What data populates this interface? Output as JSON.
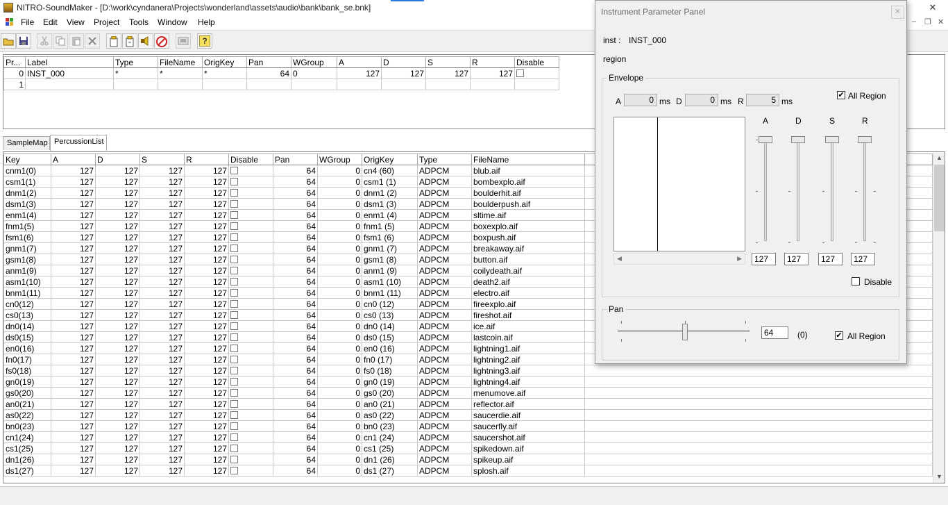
{
  "window": {
    "title": "NITRO-SoundMaker - [D:\\work\\cyndanera\\Projects\\wonderland\\assets\\audio\\bank\\bank_se.bnk]",
    "minimize": "—",
    "maximize": "☐",
    "close": "✕"
  },
  "menu": {
    "file": "File",
    "edit": "Edit",
    "view": "View",
    "project": "Project",
    "tools": "Tools",
    "window": "Window",
    "help": "Help",
    "mdi_min": "–",
    "mdi_restore": "❐",
    "mdi_close": "✕"
  },
  "toolbar": {
    "help_glyph": "?"
  },
  "instrument_table": {
    "headers": [
      "Pr...",
      "Label",
      "Type",
      "FileName",
      "OrigKey",
      "Pan",
      "WGroup",
      "A",
      "D",
      "S",
      "R",
      "Disable"
    ],
    "rows": [
      {
        "prg": "0",
        "label": "INST_000",
        "type": "*",
        "file": "*",
        "origkey": "*",
        "pan": "64",
        "wgroup": "0",
        "a": "127",
        "d": "127",
        "s": "127",
        "r": "127"
      },
      {
        "prg": "1",
        "label": "",
        "type": "",
        "file": "",
        "origkey": "",
        "pan": "",
        "wgroup": "",
        "a": "",
        "d": "",
        "s": "",
        "r": ""
      }
    ]
  },
  "tabs": {
    "samplemap": "SampleMap",
    "percussion": "PercussionList"
  },
  "perc_table": {
    "headers": [
      "Key",
      "A",
      "D",
      "S",
      "R",
      "Disable",
      "Pan",
      "WGroup",
      "OrigKey",
      "Type",
      "FileName"
    ],
    "rows": [
      {
        "key": "cnm1(0)",
        "a": "127",
        "d": "127",
        "s": "127",
        "r": "127",
        "pan": "64",
        "wg": "0",
        "ok": "cn4 (60)",
        "type": "ADPCM",
        "file": "blub.aif"
      },
      {
        "key": "csm1(1)",
        "a": "127",
        "d": "127",
        "s": "127",
        "r": "127",
        "pan": "64",
        "wg": "0",
        "ok": "csm1 (1)",
        "type": "ADPCM",
        "file": "bombexplo.aif"
      },
      {
        "key": "dnm1(2)",
        "a": "127",
        "d": "127",
        "s": "127",
        "r": "127",
        "pan": "64",
        "wg": "0",
        "ok": "dnm1 (2)",
        "type": "ADPCM",
        "file": "boulderhit.aif"
      },
      {
        "key": "dsm1(3)",
        "a": "127",
        "d": "127",
        "s": "127",
        "r": "127",
        "pan": "64",
        "wg": "0",
        "ok": "dsm1 (3)",
        "type": "ADPCM",
        "file": "boulderpush.aif"
      },
      {
        "key": "enm1(4)",
        "a": "127",
        "d": "127",
        "s": "127",
        "r": "127",
        "pan": "64",
        "wg": "0",
        "ok": "enm1 (4)",
        "type": "ADPCM",
        "file": "sltime.aif"
      },
      {
        "key": "fnm1(5)",
        "a": "127",
        "d": "127",
        "s": "127",
        "r": "127",
        "pan": "64",
        "wg": "0",
        "ok": "fnm1 (5)",
        "type": "ADPCM",
        "file": "boxexplo.aif"
      },
      {
        "key": "fsm1(6)",
        "a": "127",
        "d": "127",
        "s": "127",
        "r": "127",
        "pan": "64",
        "wg": "0",
        "ok": "fsm1 (6)",
        "type": "ADPCM",
        "file": "boxpush.aif"
      },
      {
        "key": "gnm1(7)",
        "a": "127",
        "d": "127",
        "s": "127",
        "r": "127",
        "pan": "64",
        "wg": "0",
        "ok": "gnm1 (7)",
        "type": "ADPCM",
        "file": "breakaway.aif"
      },
      {
        "key": "gsm1(8)",
        "a": "127",
        "d": "127",
        "s": "127",
        "r": "127",
        "pan": "64",
        "wg": "0",
        "ok": "gsm1 (8)",
        "type": "ADPCM",
        "file": "button.aif"
      },
      {
        "key": "anm1(9)",
        "a": "127",
        "d": "127",
        "s": "127",
        "r": "127",
        "pan": "64",
        "wg": "0",
        "ok": "anm1 (9)",
        "type": "ADPCM",
        "file": "coilydeath.aif"
      },
      {
        "key": "asm1(10)",
        "a": "127",
        "d": "127",
        "s": "127",
        "r": "127",
        "pan": "64",
        "wg": "0",
        "ok": "asm1 (10)",
        "type": "ADPCM",
        "file": "death2.aif"
      },
      {
        "key": "bnm1(11)",
        "a": "127",
        "d": "127",
        "s": "127",
        "r": "127",
        "pan": "64",
        "wg": "0",
        "ok": "bnm1 (11)",
        "type": "ADPCM",
        "file": "electro.aif"
      },
      {
        "key": "cn0(12)",
        "a": "127",
        "d": "127",
        "s": "127",
        "r": "127",
        "pan": "64",
        "wg": "0",
        "ok": "cn0 (12)",
        "type": "ADPCM",
        "file": "fireexplo.aif"
      },
      {
        "key": "cs0(13)",
        "a": "127",
        "d": "127",
        "s": "127",
        "r": "127",
        "pan": "64",
        "wg": "0",
        "ok": "cs0 (13)",
        "type": "ADPCM",
        "file": "fireshot.aif"
      },
      {
        "key": "dn0(14)",
        "a": "127",
        "d": "127",
        "s": "127",
        "r": "127",
        "pan": "64",
        "wg": "0",
        "ok": "dn0 (14)",
        "type": "ADPCM",
        "file": "ice.aif"
      },
      {
        "key": "ds0(15)",
        "a": "127",
        "d": "127",
        "s": "127",
        "r": "127",
        "pan": "64",
        "wg": "0",
        "ok": "ds0 (15)",
        "type": "ADPCM",
        "file": "lastcoin.aif"
      },
      {
        "key": "en0(16)",
        "a": "127",
        "d": "127",
        "s": "127",
        "r": "127",
        "pan": "64",
        "wg": "0",
        "ok": "en0 (16)",
        "type": "ADPCM",
        "file": "lightning1.aif"
      },
      {
        "key": "fn0(17)",
        "a": "127",
        "d": "127",
        "s": "127",
        "r": "127",
        "pan": "64",
        "wg": "0",
        "ok": "fn0 (17)",
        "type": "ADPCM",
        "file": "lightning2.aif"
      },
      {
        "key": "fs0(18)",
        "a": "127",
        "d": "127",
        "s": "127",
        "r": "127",
        "pan": "64",
        "wg": "0",
        "ok": "fs0 (18)",
        "type": "ADPCM",
        "file": "lightning3.aif"
      },
      {
        "key": "gn0(19)",
        "a": "127",
        "d": "127",
        "s": "127",
        "r": "127",
        "pan": "64",
        "wg": "0",
        "ok": "gn0 (19)",
        "type": "ADPCM",
        "file": "lightning4.aif"
      },
      {
        "key": "gs0(20)",
        "a": "127",
        "d": "127",
        "s": "127",
        "r": "127",
        "pan": "64",
        "wg": "0",
        "ok": "gs0 (20)",
        "type": "ADPCM",
        "file": "menumove.aif"
      },
      {
        "key": "an0(21)",
        "a": "127",
        "d": "127",
        "s": "127",
        "r": "127",
        "pan": "64",
        "wg": "0",
        "ok": "an0 (21)",
        "type": "ADPCM",
        "file": "reflector.aif"
      },
      {
        "key": "as0(22)",
        "a": "127",
        "d": "127",
        "s": "127",
        "r": "127",
        "pan": "64",
        "wg": "0",
        "ok": "as0 (22)",
        "type": "ADPCM",
        "file": "saucerdie.aif"
      },
      {
        "key": "bn0(23)",
        "a": "127",
        "d": "127",
        "s": "127",
        "r": "127",
        "pan": "64",
        "wg": "0",
        "ok": "bn0 (23)",
        "type": "ADPCM",
        "file": "saucerfly.aif"
      },
      {
        "key": "cn1(24)",
        "a": "127",
        "d": "127",
        "s": "127",
        "r": "127",
        "pan": "64",
        "wg": "0",
        "ok": "cn1 (24)",
        "type": "ADPCM",
        "file": "saucershot.aif"
      },
      {
        "key": "cs1(25)",
        "a": "127",
        "d": "127",
        "s": "127",
        "r": "127",
        "pan": "64",
        "wg": "0",
        "ok": "cs1 (25)",
        "type": "ADPCM",
        "file": "spikedown.aif"
      },
      {
        "key": "dn1(26)",
        "a": "127",
        "d": "127",
        "s": "127",
        "r": "127",
        "pan": "64",
        "wg": "0",
        "ok": "dn1 (26)",
        "type": "ADPCM",
        "file": "spikeup.aif"
      },
      {
        "key": "ds1(27)",
        "a": "127",
        "d": "127",
        "s": "127",
        "r": "127",
        "pan": "64",
        "wg": "0",
        "ok": "ds1 (27)",
        "type": "ADPCM",
        "file": "splosh.aif"
      }
    ]
  },
  "panel": {
    "title": "Instrument Parameter Panel",
    "close": "✕",
    "inst_label": "inst :",
    "inst_value": "INST_000",
    "region_label": "region",
    "envelope": {
      "legend": "Envelope",
      "a_label": "A",
      "a_value": "0",
      "d_label": "D",
      "d_value": "0",
      "r_label": "R",
      "r_value": "5",
      "unit": "ms",
      "all_region_label": "All Region",
      "all_region_checked": "✔",
      "slider_labels": [
        "A",
        "D",
        "S",
        "R"
      ],
      "slider_values": [
        "127",
        "127",
        "127",
        "127"
      ],
      "disable_label": "Disable"
    },
    "pan": {
      "legend": "Pan",
      "value": "64",
      "offset": "(0)",
      "all_region_label": "All Region",
      "all_region_checked": "✔"
    }
  }
}
